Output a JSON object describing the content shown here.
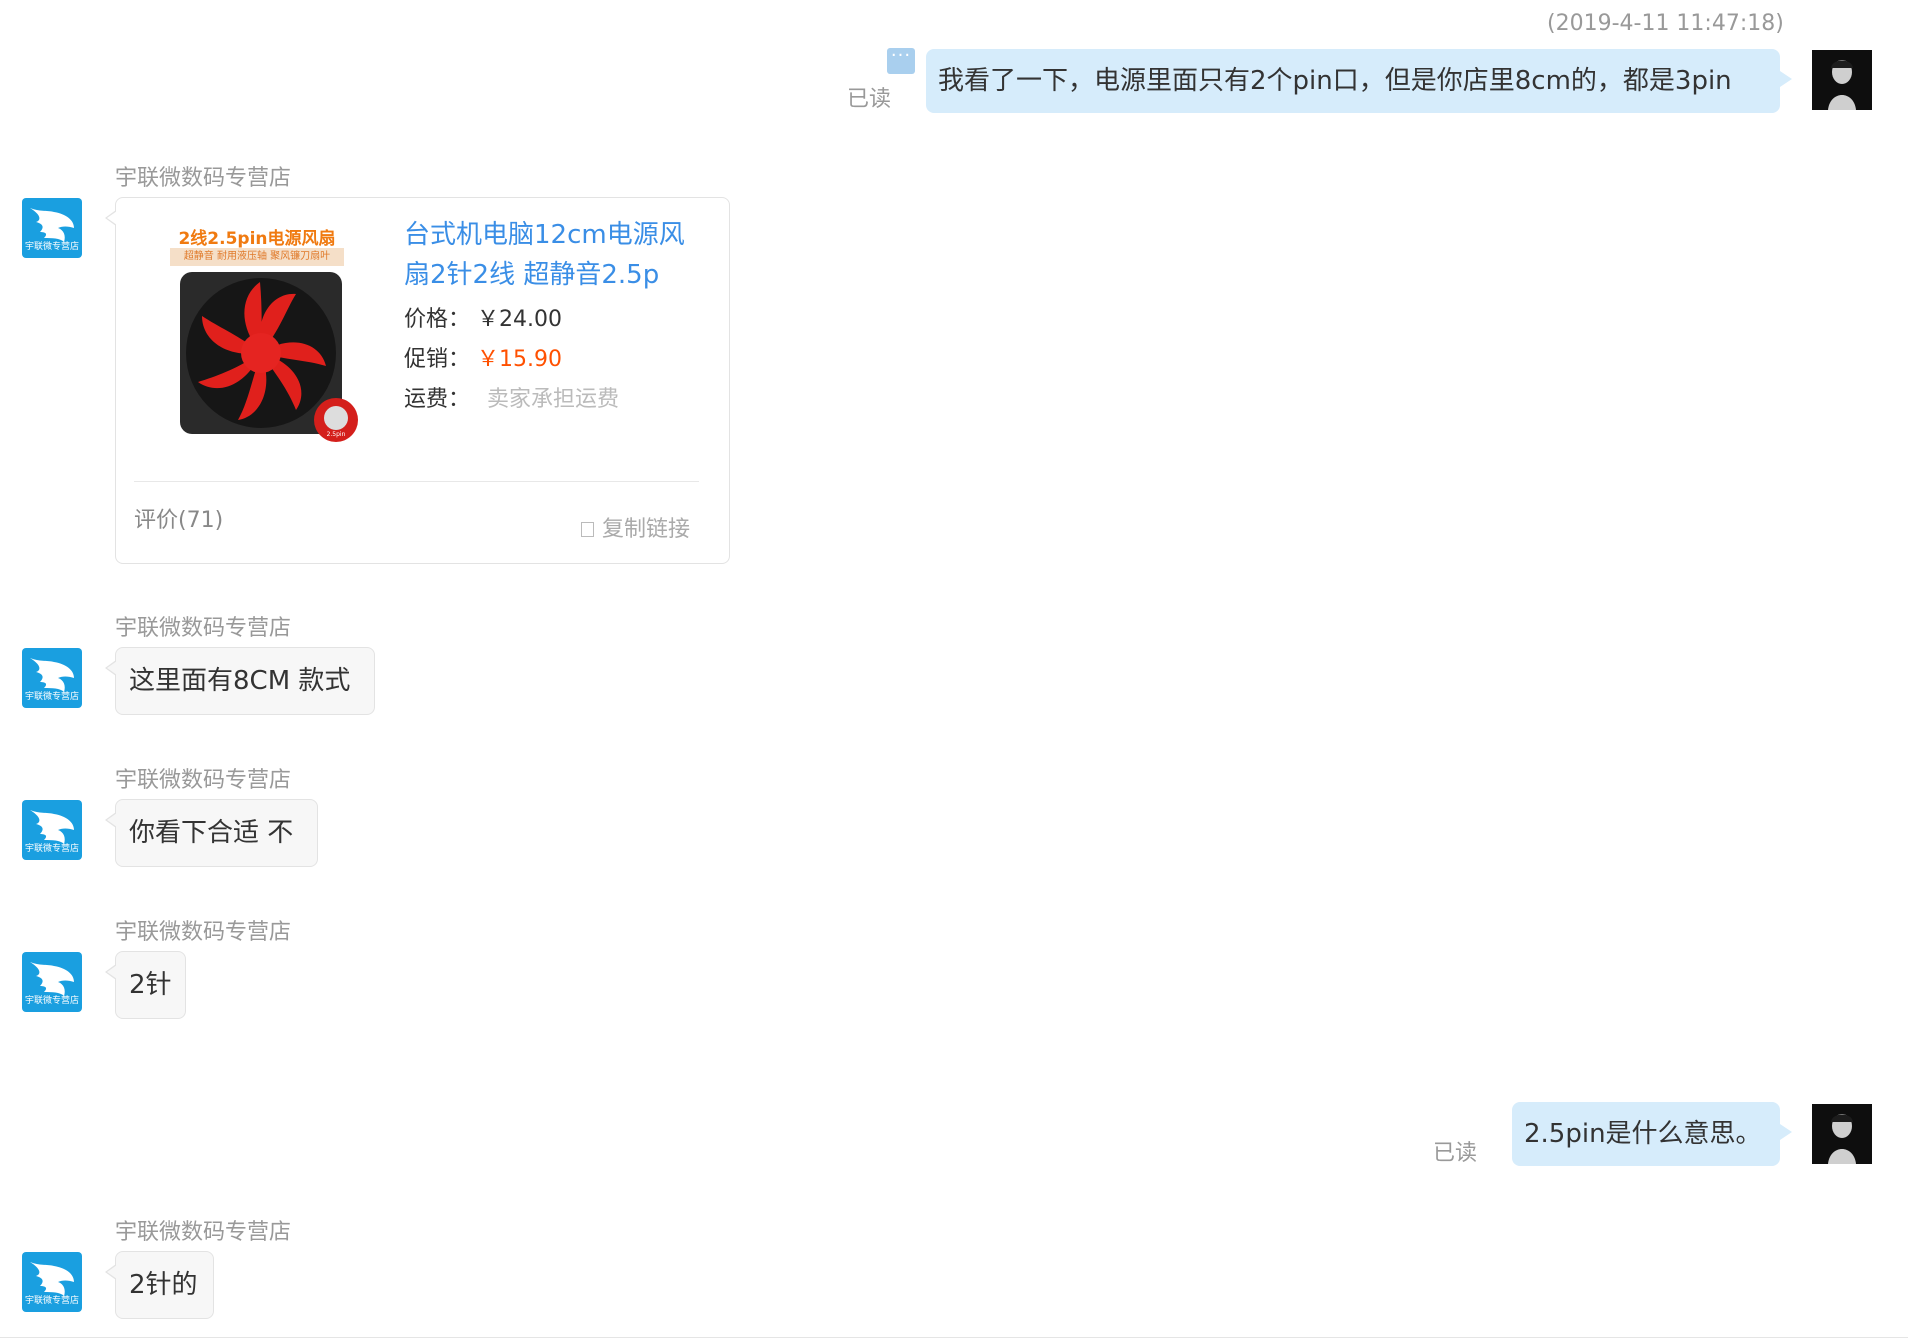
{
  "timestamp": "(2019-4-11 11:47:18)",
  "shop": {
    "name": "宇联微数码专营店",
    "avatar_text": "宇联微专营店",
    "brand_color": "#1a9fe0"
  },
  "colors": {
    "outgoing_bubble": "#d6ecfb",
    "incoming_bubble": "#f7f7f7",
    "link": "#3a8ee6",
    "promo_price": "#ff5000"
  },
  "messages": {
    "m1": {
      "text": "我看了一下，电源里面只有2个pin口，但是你店里8cm的，都是3pin",
      "status": "已读"
    },
    "m2": {
      "product": {
        "image_caption": "2线2.5pin电源风扇",
        "image_tagline": "超静音  耐用液压轴  聚风镰刀扇叶",
        "image_badge": "2.5pin",
        "title": "台式机电脑12cm电源风扇2针2线 超静音2.5p",
        "price_label": "价格：",
        "price": "￥24.00",
        "promo_label": "促销：",
        "promo_price": "￥15.90",
        "shipping_label": "运费：",
        "shipping": "卖家承担运费",
        "reviews": "评价(71)",
        "copy_link": "复制链接"
      }
    },
    "m3": {
      "text": "这里面有8CM 款式"
    },
    "m4": {
      "text": "你看下合适 不"
    },
    "m5": {
      "text": "2针"
    },
    "m6": {
      "text": "2.5pin是什么意思。",
      "status": "已读"
    },
    "m7": {
      "text": "2针的"
    }
  }
}
